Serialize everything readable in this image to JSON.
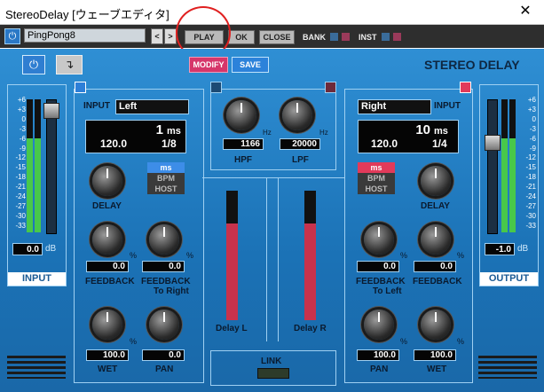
{
  "window": {
    "title": "StereoDelay [ウェーブエディタ]",
    "close_glyph": "✕"
  },
  "toolbar": {
    "preset": "PingPong8",
    "prev": "<",
    "next": ">",
    "play": "PLAY",
    "ok": "OK",
    "close": "CLOSE",
    "bank": "BANK",
    "inst": "INST"
  },
  "header": {
    "modify": "MODIFY",
    "save": "SAVE",
    "product": "STEREO DELAY"
  },
  "input_meter": {
    "scale": [
      "+6",
      "+3",
      "0",
      "-3",
      "-6",
      "-9",
      "-12",
      "-15",
      "-18",
      "-21",
      "-24",
      "-27",
      "-30",
      "-33"
    ],
    "value": "0.0",
    "unit": "dB",
    "label": "INPUT"
  },
  "output_meter": {
    "scale": [
      "+6",
      "+3",
      "0",
      "-3",
      "-6",
      "-9",
      "-12",
      "-15",
      "-18",
      "-21",
      "-24",
      "-27",
      "-30",
      "-33"
    ],
    "value": "-1.0",
    "unit": "dB",
    "label": "OUTPUT"
  },
  "left": {
    "input_label": "INPUT",
    "channel": "Left",
    "time": "1",
    "time_unit": "ms",
    "tempo": "120.0",
    "note": "1/8",
    "modes": [
      "ms",
      "BPM",
      "HOST"
    ],
    "delay": "DELAY",
    "feedback_val": "0.0",
    "feedback": "FEEDBACK",
    "cross_val": "0.0",
    "cross": "FEEDBACK",
    "cross2": "To Right",
    "wet_val": "100.0",
    "wet": "WET",
    "pan_val": "0.0",
    "pan": "PAN",
    "pct": "%"
  },
  "right": {
    "input_label": "INPUT",
    "channel": "Right",
    "time": "10",
    "time_unit": "ms",
    "tempo": "120.0",
    "note": "1/4",
    "modes": [
      "ms",
      "BPM",
      "HOST"
    ],
    "delay": "DELAY",
    "cross_val": "0.0",
    "cross": "FEEDBACK",
    "cross2": "To Left",
    "feedback_val": "0.0",
    "feedback": "FEEDBACK",
    "pan_val": "100.0",
    "pan": "PAN",
    "wet_val": "100.0",
    "wet": "WET",
    "pct": "%"
  },
  "filters": {
    "hz": "Hz",
    "hpf_val": "1166",
    "hpf": "HPF",
    "lpf_val": "20000",
    "lpf": "LPF"
  },
  "delay_bars": {
    "left": "Delay L",
    "right": "Delay R",
    "left_level": 0.75,
    "right_level": 0.75
  },
  "link": {
    "label": "LINK"
  },
  "colors": {
    "accent_red": "#e23a5a",
    "mode_active": "#3d8de8",
    "bar": "#c8324c"
  }
}
